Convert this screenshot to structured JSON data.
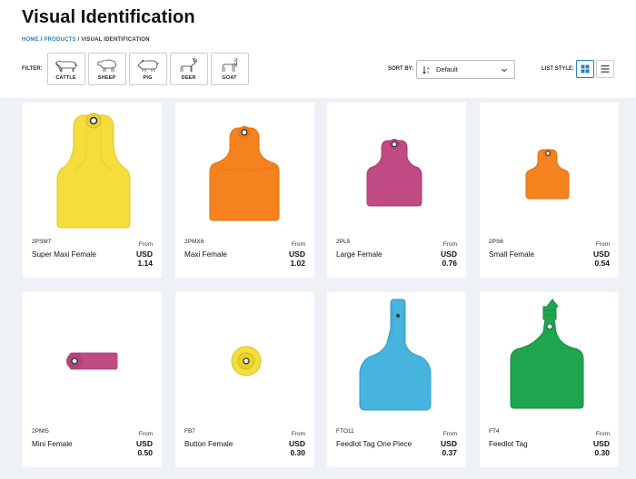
{
  "page": {
    "title": "Visual Identification"
  },
  "breadcrumb": {
    "home": "HOME",
    "sep1": " / ",
    "products": "PRODUCTS",
    "sep2": " / ",
    "current": "VISUAL IDENTIFICATION"
  },
  "filter": {
    "label": "FILTER:",
    "options": [
      {
        "label": "CATTLE",
        "icon": "cattle-icon"
      },
      {
        "label": "SHEEP",
        "icon": "sheep-icon"
      },
      {
        "label": "PIG",
        "icon": "pig-icon"
      },
      {
        "label": "DEER",
        "icon": "deer-icon"
      },
      {
        "label": "GOAT",
        "icon": "goat-icon"
      }
    ]
  },
  "sort": {
    "label": "SORT BY:",
    "value": "Default",
    "icon": "sort-az-icon"
  },
  "list_style": {
    "label": "LIST STYLE:",
    "active": "grid"
  },
  "colors": {
    "accent": "#2a7fc1",
    "yellow": "#f5dd3c",
    "orange": "#f5821f",
    "magenta": "#c04a84",
    "light_blue": "#47b4dd",
    "green": "#1ea54d"
  },
  "products": [
    {
      "sku": "2PSM7",
      "name": "Super Maxi Female",
      "from": "From",
      "currency": "USD",
      "price": "1.14",
      "color": "#f5dd3c"
    },
    {
      "sku": "2PMX6",
      "name": "Maxi Female",
      "from": "From",
      "currency": "USD",
      "price": "1.02",
      "color": "#f5821f"
    },
    {
      "sku": "2PL5",
      "name": "Large Female",
      "from": "From",
      "currency": "USD",
      "price": "0.76",
      "color": "#c04a84"
    },
    {
      "sku": "2PS6",
      "name": "Small Female",
      "from": "From",
      "currency": "USD",
      "price": "0.54",
      "color": "#f5821f"
    },
    {
      "sku": "2PMI5",
      "name": "Mini Female",
      "from": "From",
      "currency": "USD",
      "price": "0.50",
      "color": "#c04a84"
    },
    {
      "sku": "FB7",
      "name": "Button Female",
      "from": "From",
      "currency": "USD",
      "price": "0.30",
      "color": "#f5dd3c"
    },
    {
      "sku": "FTO11",
      "name": "Feedlot Tag One Piece",
      "from": "From",
      "currency": "USD",
      "price": "0.37",
      "color": "#47b4dd"
    },
    {
      "sku": "FT4",
      "name": "Feedlot Tag",
      "from": "From",
      "currency": "USD",
      "price": "0.30",
      "color": "#1ea54d"
    }
  ]
}
